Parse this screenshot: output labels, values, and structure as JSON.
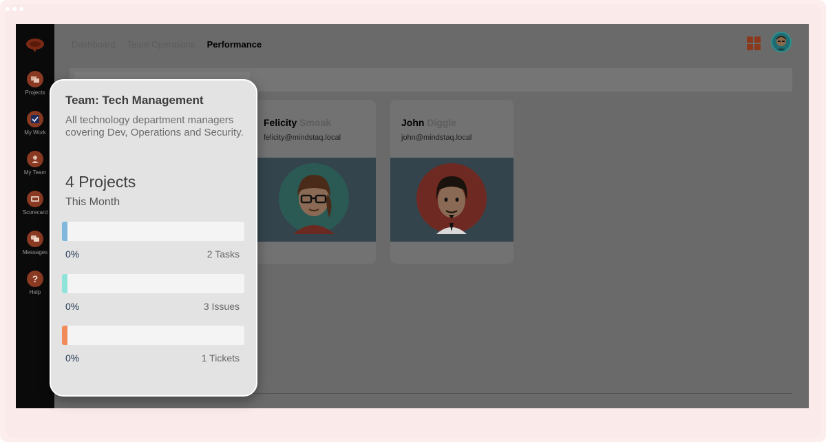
{
  "sidebar": {
    "items": [
      {
        "label": "Projects",
        "icon": "projects-icon"
      },
      {
        "label": "My Work",
        "icon": "checkbox-icon"
      },
      {
        "label": "My Team",
        "icon": "person-icon"
      },
      {
        "label": "Scorecard",
        "icon": "scorecard-icon"
      },
      {
        "label": "Messages",
        "icon": "chat-icon"
      },
      {
        "label": "Help",
        "icon": "question-icon"
      }
    ]
  },
  "header": {
    "tabs": [
      {
        "label": "Dashboard",
        "active": false
      },
      {
        "label": "Team Operations",
        "active": false
      },
      {
        "label": "Performance",
        "active": true
      }
    ]
  },
  "members": [
    {
      "first": "Felicity",
      "last": "Smoak",
      "email": "felicity@mindstaq.local"
    },
    {
      "first": "John",
      "last": "Diggle",
      "email": "john@mindstaq.local"
    }
  ],
  "popup": {
    "title": "Team: Tech Management",
    "description": "All technology department managers covering Dev, Operations and Security.",
    "count": "4 Projects",
    "period": "This Month",
    "bars": [
      {
        "percent": "0%",
        "label": "2 Tasks",
        "color": "#7fb8dc",
        "progress": 0
      },
      {
        "percent": "0%",
        "label": "3 Issues",
        "color": "#8fe3d8",
        "progress": 0
      },
      {
        "percent": "0%",
        "label": "1 Tickets",
        "color": "#f08a58",
        "progress": 0
      }
    ]
  },
  "colors": {
    "accent": "#c0492a",
    "sidebar": "#0a0a0a",
    "overlay": "#6a6a6a"
  }
}
